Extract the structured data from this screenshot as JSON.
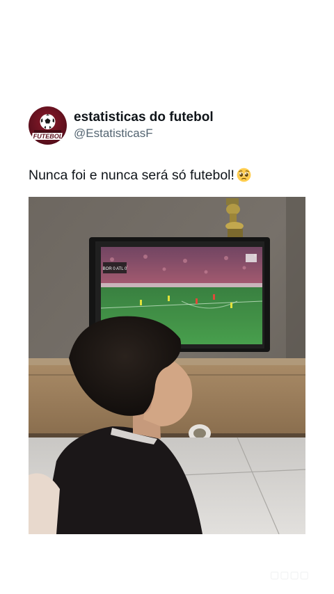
{
  "tweet": {
    "display_name": "estatisticas do futebol",
    "handle": "@EstatisticasF",
    "text": "Nunca foi e nunca será só futebol!",
    "emoji_icon": "pleading-face-emoji",
    "avatar": {
      "logo_text": "FUTEBOL",
      "colors": {
        "background": "#5a0f1c",
        "ball": "#ffffff"
      }
    }
  },
  "media": {
    "type": "video-frame",
    "tv_scoreboard": "BOR 0  ATL 0"
  },
  "colors": {
    "text_primary": "#0f1419",
    "text_secondary": "#536471",
    "background": "#ffffff"
  }
}
